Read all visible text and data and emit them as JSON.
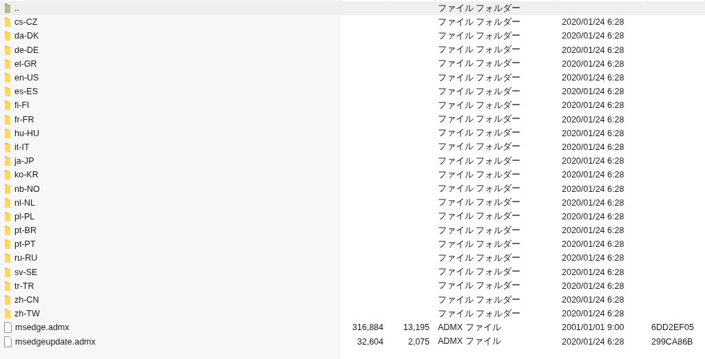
{
  "rows": [
    {
      "kind": "parent",
      "name": "..",
      "size": "",
      "packed": "",
      "type": "ファイル フォルダー",
      "modified": "",
      "crc": "",
      "selected": true
    },
    {
      "kind": "folder",
      "name": "cs-CZ",
      "type": "ファイル フォルダー",
      "modified": "2020/01/24 6:28",
      "selected": false
    },
    {
      "kind": "folder",
      "name": "da-DK",
      "type": "ファイル フォルダー",
      "modified": "2020/01/24 6:28",
      "selected": false
    },
    {
      "kind": "folder",
      "name": "de-DE",
      "type": "ファイル フォルダー",
      "modified": "2020/01/24 6:28",
      "selected": false
    },
    {
      "kind": "folder",
      "name": "el-GR",
      "type": "ファイル フォルダー",
      "modified": "2020/01/24 6:28",
      "selected": false
    },
    {
      "kind": "folder",
      "name": "en-US",
      "type": "ファイル フォルダー",
      "modified": "2020/01/24 6:28",
      "selected": false
    },
    {
      "kind": "folder",
      "name": "es-ES",
      "type": "ファイル フォルダー",
      "modified": "2020/01/24 6:28",
      "selected": false
    },
    {
      "kind": "folder",
      "name": "fi-FI",
      "type": "ファイル フォルダー",
      "modified": "2020/01/24 6:28",
      "selected": false
    },
    {
      "kind": "folder",
      "name": "fr-FR",
      "type": "ファイル フォルダー",
      "modified": "2020/01/24 6:28",
      "selected": false
    },
    {
      "kind": "folder",
      "name": "hu-HU",
      "type": "ファイル フォルダー",
      "modified": "2020/01/24 6:28",
      "selected": false
    },
    {
      "kind": "folder",
      "name": "it-IT",
      "type": "ファイル フォルダー",
      "modified": "2020/01/24 6:28",
      "selected": false
    },
    {
      "kind": "folder",
      "name": "ja-JP",
      "type": "ファイル フォルダー",
      "modified": "2020/01/24 6:28",
      "selected": false
    },
    {
      "kind": "folder",
      "name": "ko-KR",
      "type": "ファイル フォルダー",
      "modified": "2020/01/24 6:28",
      "selected": false
    },
    {
      "kind": "folder",
      "name": "nb-NO",
      "type": "ファイル フォルダー",
      "modified": "2020/01/24 6:28",
      "selected": false
    },
    {
      "kind": "folder",
      "name": "nl-NL",
      "type": "ファイル フォルダー",
      "modified": "2020/01/24 6:28",
      "selected": false
    },
    {
      "kind": "folder",
      "name": "pl-PL",
      "type": "ファイル フォルダー",
      "modified": "2020/01/24 6:28",
      "selected": false
    },
    {
      "kind": "folder",
      "name": "pt-BR",
      "type": "ファイル フォルダー",
      "modified": "2020/01/24 6:28",
      "selected": false
    },
    {
      "kind": "folder",
      "name": "pt-PT",
      "type": "ファイル フォルダー",
      "modified": "2020/01/24 6:28",
      "selected": false
    },
    {
      "kind": "folder",
      "name": "ru-RU",
      "type": "ファイル フォルダー",
      "modified": "2020/01/24 6:28",
      "selected": false
    },
    {
      "kind": "folder",
      "name": "sv-SE",
      "type": "ファイル フォルダー",
      "modified": "2020/01/24 6:28",
      "selected": false
    },
    {
      "kind": "folder",
      "name": "tr-TR",
      "type": "ファイル フォルダー",
      "modified": "2020/01/24 6:28",
      "selected": false
    },
    {
      "kind": "folder",
      "name": "zh-CN",
      "type": "ファイル フォルダー",
      "modified": "2020/01/24 6:28",
      "selected": false
    },
    {
      "kind": "folder",
      "name": "zh-TW",
      "type": "ファイル フォルダー",
      "modified": "2020/01/24 6:28",
      "selected": false
    },
    {
      "kind": "file",
      "name": "msedge.admx",
      "size": "316,884",
      "packed": "13,195",
      "type": "ADMX ファイル",
      "modified": "2001/01/01 9:00",
      "crc": "6DD2EF05",
      "selected": false
    },
    {
      "kind": "file",
      "name": "msedgeupdate.admx",
      "size": "32,604",
      "packed": "2,075",
      "type": "ADMX ファイル",
      "modified": "2020/01/24 6:28",
      "crc": "299CA86B",
      "selected": false
    }
  ]
}
